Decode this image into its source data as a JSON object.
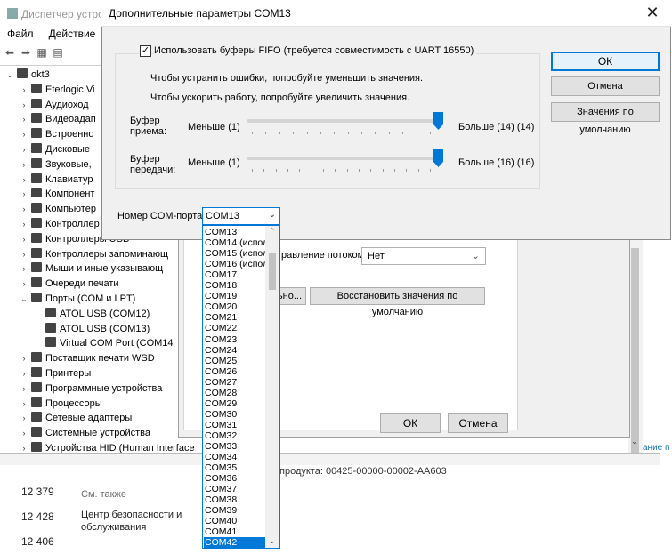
{
  "device_manager": {
    "title": "Диспетчер устро",
    "menu": [
      "Файл",
      "Действие"
    ],
    "tree": [
      {
        "label": "okt3",
        "chev": "⌄",
        "indent": 0
      },
      {
        "label": "Eterlogic Vi",
        "chev": "›",
        "indent": 1
      },
      {
        "label": "Аудиоход",
        "chev": "›",
        "indent": 1
      },
      {
        "label": "Видеоадап",
        "chev": "›",
        "indent": 1
      },
      {
        "label": "Встроенно",
        "chev": "›",
        "indent": 1
      },
      {
        "label": "Дисковые",
        "chev": "›",
        "indent": 1
      },
      {
        "label": "Звуковые,",
        "chev": "›",
        "indent": 1
      },
      {
        "label": "Клавиатур",
        "chev": "›",
        "indent": 1
      },
      {
        "label": "Компонент",
        "chev": "›",
        "indent": 1
      },
      {
        "label": "Компьютер",
        "chev": "›",
        "indent": 1
      },
      {
        "label": "Контроллер",
        "chev": "›",
        "indent": 1
      },
      {
        "label": "Контроллеры USB",
        "chev": "›",
        "indent": 1
      },
      {
        "label": "Контроллеры запоминающ",
        "chev": "›",
        "indent": 1
      },
      {
        "label": "Мыши и иные указывающ",
        "chev": "›",
        "indent": 1
      },
      {
        "label": "Очереди печати",
        "chev": "›",
        "indent": 1
      },
      {
        "label": "Порты (COM и LPT)",
        "chev": "⌄",
        "indent": 1
      },
      {
        "label": "ATOL USB (COM12)",
        "chev": "",
        "indent": 2
      },
      {
        "label": "ATOL USB (COM13)",
        "chev": "",
        "indent": 2
      },
      {
        "label": "Virtual COM Port (COM14",
        "chev": "",
        "indent": 2
      },
      {
        "label": "Поставщик печати WSD",
        "chev": "›",
        "indent": 1
      },
      {
        "label": "Принтеры",
        "chev": "›",
        "indent": 1
      },
      {
        "label": "Программные устройства",
        "chev": "›",
        "indent": 1
      },
      {
        "label": "Процессоры",
        "chev": "›",
        "indent": 1
      },
      {
        "label": "Сетевые адаптеры",
        "chev": "›",
        "indent": 1
      },
      {
        "label": "Системные устройства",
        "chev": "›",
        "indent": 1
      },
      {
        "label": "Устройства HID (Human Interface",
        "chev": "›",
        "indent": 1
      }
    ]
  },
  "background": {
    "file_numbers": [
      "12 379",
      "12 428",
      "12 406"
    ],
    "see_also": "См. также",
    "security_link": "Центр безопасности и обслуживания",
    "product_id": "продукта: 00425-00000-00002-AA603",
    "right_link": "ание п"
  },
  "port_dialog": {
    "flow_label": "равление потоком:",
    "flow_value": "Нет",
    "advanced_button": "льно...",
    "restore_button": "Восстановить значения по умолчанию",
    "ok": "ОК",
    "cancel": "Отмена"
  },
  "advanced": {
    "title": "Дополнительные параметры COM13",
    "fifo_label": "Использовать буферы FIFO (требуется совместимость с UART 16550)",
    "fifo_checked": true,
    "hint1": "Чтобы устранить ошибки, попробуйте уменьшить значения.",
    "hint2": "Чтобы ускорить работу, попробуйте увеличить значения.",
    "receive": {
      "label_line1": "Буфер",
      "label_line2": "приема:",
      "min": "Меньше (1)",
      "max": "Больше (14) (14)",
      "value": 14,
      "range": [
        1,
        14
      ]
    },
    "transmit": {
      "label_line1": "Буфер",
      "label_line2": "передачи:",
      "min": "Меньше (1)",
      "max": "Больше (16) (16)",
      "value": 16,
      "range": [
        1,
        16
      ]
    },
    "ok": "ОК",
    "cancel": "Отмена",
    "defaults": "Значения по умолчанию",
    "port_number_label": "Номер COM-порта:",
    "port_number_value": "COM13",
    "dropdown": [
      "COM13",
      "COM14 (испол",
      "COM15 (испол",
      "COM16 (испол",
      "COM17",
      "COM18",
      "COM19",
      "COM20",
      "COM21",
      "COM22",
      "COM23",
      "COM24",
      "COM25",
      "COM26",
      "COM27",
      "COM28",
      "COM29",
      "COM30",
      "COM31",
      "COM32",
      "COM33",
      "COM34",
      "COM35",
      "COM36",
      "COM37",
      "COM38",
      "COM39",
      "COM40",
      "COM41",
      "COM42"
    ],
    "dropdown_selected": "COM42"
  },
  "colors": {
    "accent": "#0078d7",
    "dialog_bg": "#f0f0f0"
  }
}
